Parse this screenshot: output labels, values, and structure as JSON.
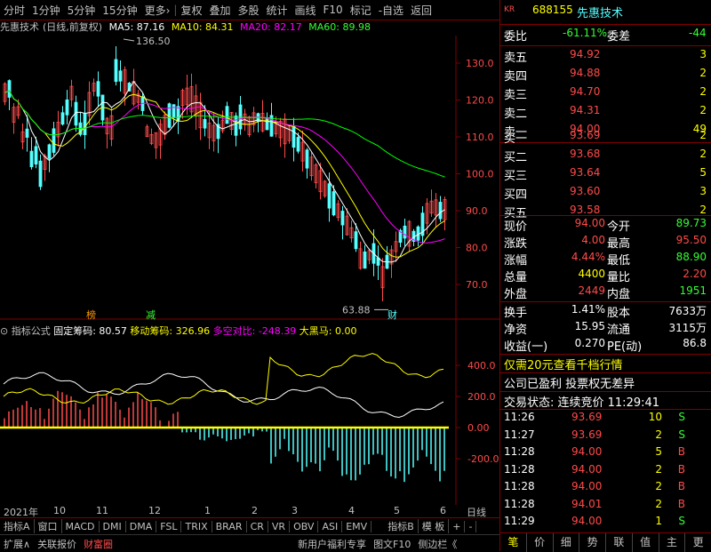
{
  "toolbar": {
    "items": [
      "分时",
      "1分钟",
      "5分钟",
      "15分钟",
      "更多›",
      "复权",
      "叠加",
      "多股",
      "统计",
      "画线",
      "F10",
      "标记",
      "-自选",
      "返回"
    ]
  },
  "title": {
    "name": "先惠技术",
    "mode": "(日线,前复权)",
    "ma5": "MA5: 87.16",
    "ma10": "MA10: 84.31",
    "ma20": "MA20: 82.17",
    "ma60": "MA60: 89.98"
  },
  "price_axis": [
    "130.0",
    "120.0",
    "110.0",
    "100.0",
    "90.0",
    "80.0",
    "70.0"
  ],
  "annotations": {
    "high": "136.50",
    "low": "63.88",
    "tag1": "榜",
    "tag2": "减",
    "tag3": "财"
  },
  "indicator": {
    "label": "指标公式",
    "fixed": "固定筹码: 80.57",
    "moving": "移动筹码: 326.96",
    "ratio": "多空对比: -248.39",
    "black": "大黑马: 0.00",
    "axis": [
      "400.0",
      "200.0",
      "0.00",
      "-200.0"
    ]
  },
  "date_axis": [
    "2021年",
    "10",
    "11",
    "12",
    "1",
    "2",
    "3",
    "4",
    "5",
    "6",
    "日线"
  ],
  "tabs": [
    "指标A",
    "窗口",
    "MACD",
    "DMI",
    "DMA",
    "FSL",
    "TRIX",
    "BRAR",
    "CR",
    "VR",
    "OBV",
    "ASI",
    "EMV",
    "指标B",
    "模 板",
    "+",
    "-"
  ],
  "statusbar": [
    "扩展∧",
    "关联报价",
    "财富圈",
    "新用户福利专享",
    "图文F10",
    "侧边栏《"
  ],
  "quote": {
    "code": "688155",
    "badge": "KR",
    "name": "先惠技术",
    "weibi_label": "委比",
    "weibi": "-61.11%",
    "weicha_label": "委差",
    "weicha": "-44",
    "asks": [
      {
        "label": "卖五",
        "price": "94.92",
        "vol": "3"
      },
      {
        "label": "卖四",
        "price": "94.88",
        "vol": "2"
      },
      {
        "label": "卖三",
        "price": "94.70",
        "vol": "2"
      },
      {
        "label": "卖二",
        "price": "94.31",
        "vol": "2"
      },
      {
        "label": "卖一",
        "price": "94.00",
        "vol": "49"
      }
    ],
    "bids": [
      {
        "label": "买一",
        "price": "93.69",
        "vol": "2"
      },
      {
        "label": "买二",
        "price": "93.68",
        "vol": "2"
      },
      {
        "label": "买三",
        "price": "93.64",
        "vol": "5"
      },
      {
        "label": "买四",
        "price": "93.60",
        "vol": "3"
      },
      {
        "label": "买五",
        "price": "93.58",
        "vol": "2"
      }
    ],
    "stats": [
      {
        "l1": "现价",
        "v1": "94.00",
        "c1": "red",
        "l2": "今开",
        "v2": "89.73",
        "c2": "grn"
      },
      {
        "l1": "涨跌",
        "v1": "4.00",
        "c1": "red",
        "l2": "最高",
        "v2": "95.50",
        "c2": "red"
      },
      {
        "l1": "涨幅",
        "v1": "4.44%",
        "c1": "red",
        "l2": "最低",
        "v2": "88.90",
        "c2": "grn"
      },
      {
        "l1": "总量",
        "v1": "4400",
        "c1": "yel",
        "l2": "量比",
        "v2": "2.20",
        "c2": "red"
      },
      {
        "l1": "外盘",
        "v1": "2449",
        "c1": "red",
        "l2": "内盘",
        "v2": "1951",
        "c2": "grn"
      }
    ],
    "stats2": [
      {
        "l1": "换手",
        "v1": "1.41%",
        "l2": "股本",
        "v2": "7633万"
      },
      {
        "l1": "净资",
        "v1": "15.95",
        "l2": "流通",
        "v2": "3115万"
      },
      {
        "l1": "收益(一)",
        "v1": "0.270",
        "l2": "PE(动)",
        "v2": "86.8"
      }
    ],
    "promo": "仅需20元查看千档行情",
    "info": "公司已盈利 投票权无差异",
    "trade_status": "交易状态: 连续竞价 11:29:41",
    "ticks": [
      {
        "t": "11:26",
        "p": "93.69",
        "v": "10",
        "d": "S"
      },
      {
        "t": "11:27",
        "p": "93.69",
        "v": "2",
        "d": "S"
      },
      {
        "t": "11:28",
        "p": "94.00",
        "v": "5",
        "d": "B"
      },
      {
        "t": "11:28",
        "p": "94.00",
        "v": "2",
        "d": "B"
      },
      {
        "t": "11:28",
        "p": "94.00",
        "v": "2",
        "d": "B"
      },
      {
        "t": "11:28",
        "p": "94.01",
        "v": "2",
        "d": "B"
      },
      {
        "t": "11:29",
        "p": "94.00",
        "v": "1",
        "d": "S"
      }
    ],
    "bottom_tabs": [
      "笔",
      "价",
      "细",
      "势",
      "联",
      "值",
      "主",
      "更"
    ]
  },
  "colors": {
    "up": "#ff4a4a",
    "down": "#54ffff",
    "ma5": "#ffffff",
    "ma10": "#ffff00",
    "ma20": "#ff00ff",
    "ma60": "#00ff00",
    "frame": "#800000"
  }
}
